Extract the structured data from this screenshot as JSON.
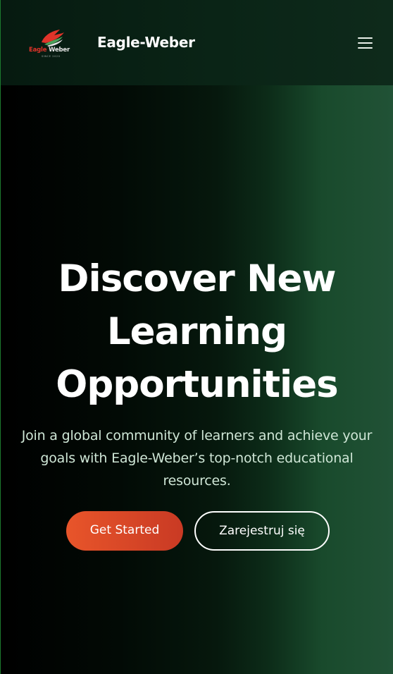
{
  "header": {
    "logo": {
      "word_primary": "Eagle",
      "word_secondary": "Weber",
      "tagline": "SINCE 2020",
      "icon": "eagle-logo-icon",
      "colors": {
        "red": "#e0342a",
        "green": "#4aa15a"
      }
    },
    "brand_title": "Eagle-Weber",
    "menu_icon": "hamburger-menu-icon"
  },
  "hero": {
    "title": "Discover New Learning Opportunities",
    "subtitle": "Join a global community of learners and achieve your goals with Eagle-Weber’s top-notch educational resources.",
    "primary_button": "Get Started",
    "secondary_button": "Zarejestruj się"
  },
  "colors": {
    "accent": "#e8552a",
    "header_bg": "#0a2416",
    "hero_dark": "#000000",
    "hero_green": "#215236",
    "subtitle_text": "#cfe6d6"
  }
}
